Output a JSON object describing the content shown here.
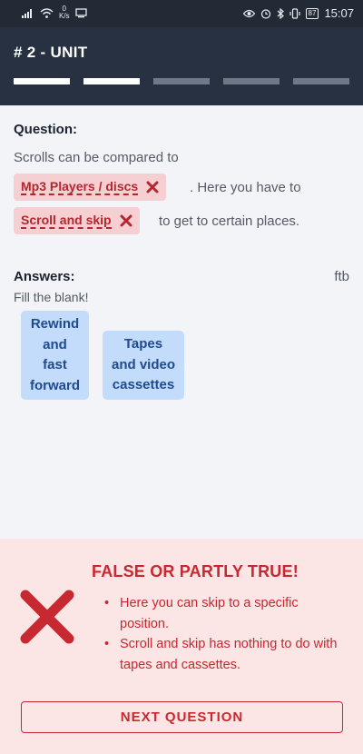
{
  "status_bar": {
    "speed_value": "0",
    "speed_unit": "K/s",
    "battery": "87",
    "time": "15:07"
  },
  "header": {
    "title": "# 2 - UNIT",
    "progress": {
      "total_segments": 5,
      "completed_segments": 2
    }
  },
  "question": {
    "label": "Question:",
    "line1": "Scrolls can be compared to",
    "chip1": "Mp3 Players / discs",
    "line2_after": ". Here you have to",
    "chip2": "Scroll and skip",
    "line3_after": "to get to certain places."
  },
  "answers": {
    "label": "Answers:",
    "type": "ftb",
    "instruction": "Fill the blank!",
    "options": [
      {
        "lines": [
          "Rewind",
          "and",
          "fast",
          "forward"
        ]
      },
      {
        "lines": [
          "Tapes",
          "and video",
          "cassettes"
        ]
      }
    ]
  },
  "feedback": {
    "title": "FALSE OR PARTLY TRUE!",
    "points": [
      "Here you can skip to a specific position.",
      "Scroll and skip has nothing to do with tapes and cassettes."
    ],
    "next_button": "NEXT QUESTION"
  },
  "colors": {
    "header_bg": "#273141",
    "error_red": "#c8282f",
    "chip_bg": "#f5cfd1",
    "answer_chip_bg": "#c3dcfb",
    "answer_text": "#1f4a8e",
    "feedback_bg": "#fce5e5"
  }
}
